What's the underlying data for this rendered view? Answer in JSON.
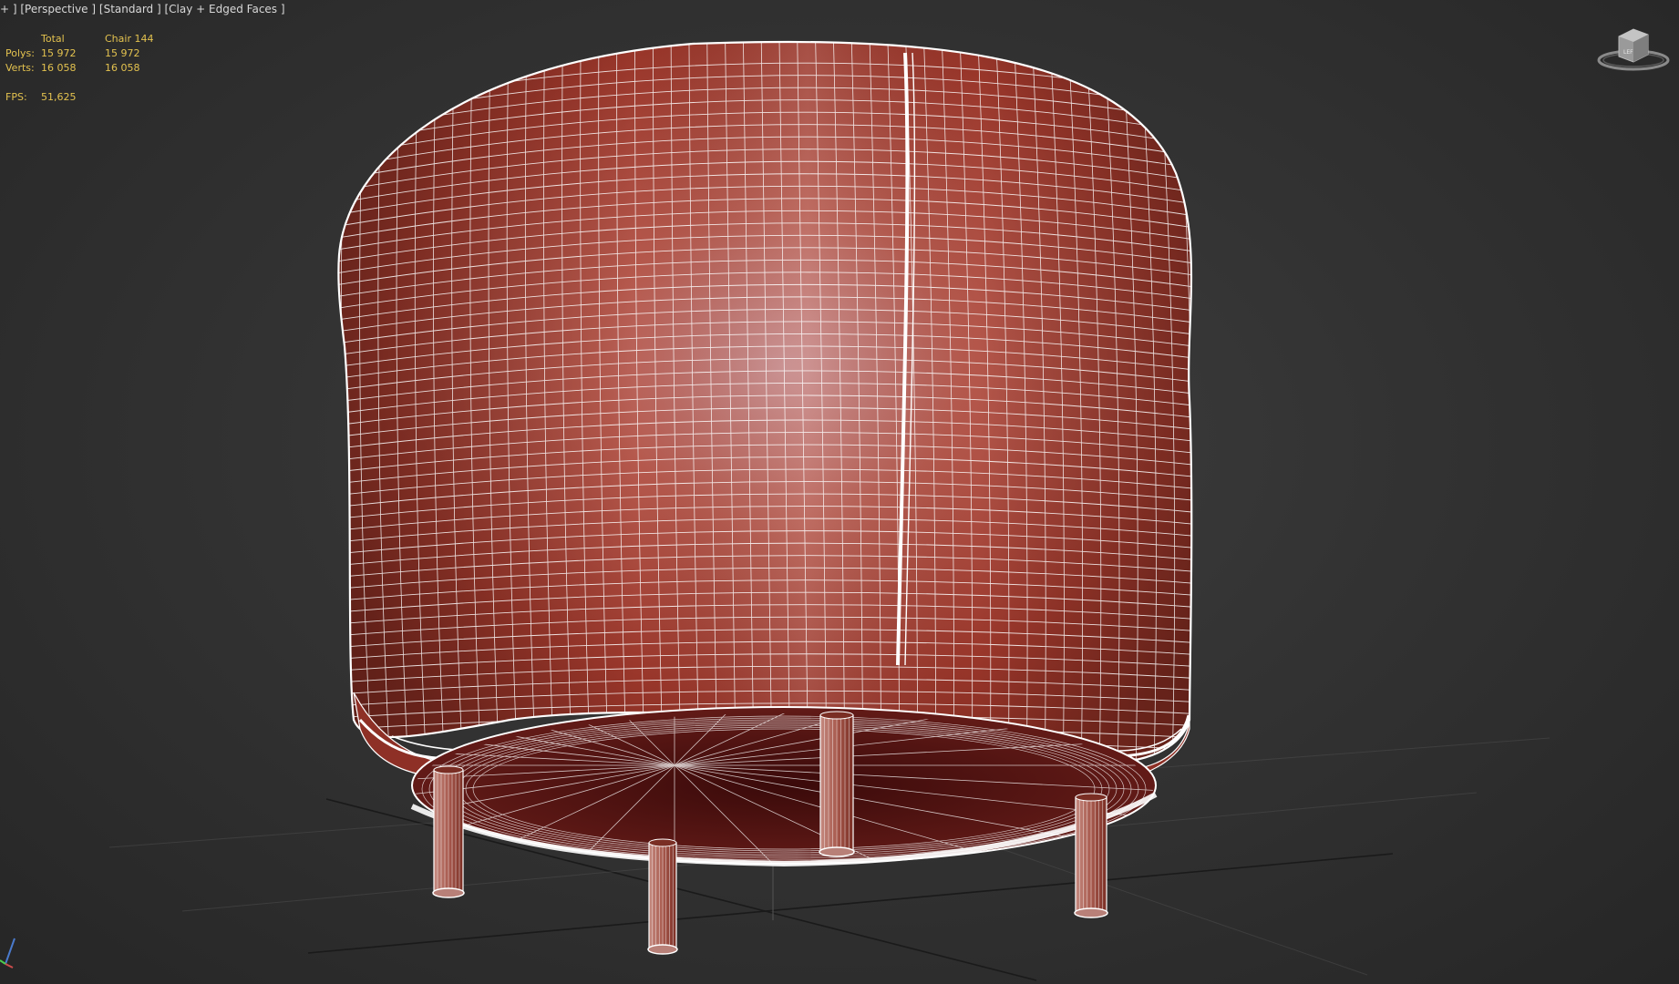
{
  "viewport": {
    "label_plus": "+",
    "label_view": "[Perspective ]",
    "label_shading": "[Standard ]",
    "label_mode": "[Clay + Edged Faces ]"
  },
  "stats": {
    "header_total": "Total",
    "header_object": "Chair 144",
    "polys_label": "Polys:",
    "polys_total": "15 972",
    "polys_object": "15 972",
    "verts_label": "Verts:",
    "verts_total": "16 058",
    "verts_object": "16 058",
    "fps_label": "FPS:",
    "fps_value": "51,625"
  },
  "colors": {
    "stats_text": "#e3c24f",
    "model_fill": "#a03a2c",
    "wire": "#ffffff",
    "viewport_bg": "#333333"
  },
  "icons": {
    "viewcube": "viewcube-icon",
    "axis": "axis-tripod-icon"
  }
}
